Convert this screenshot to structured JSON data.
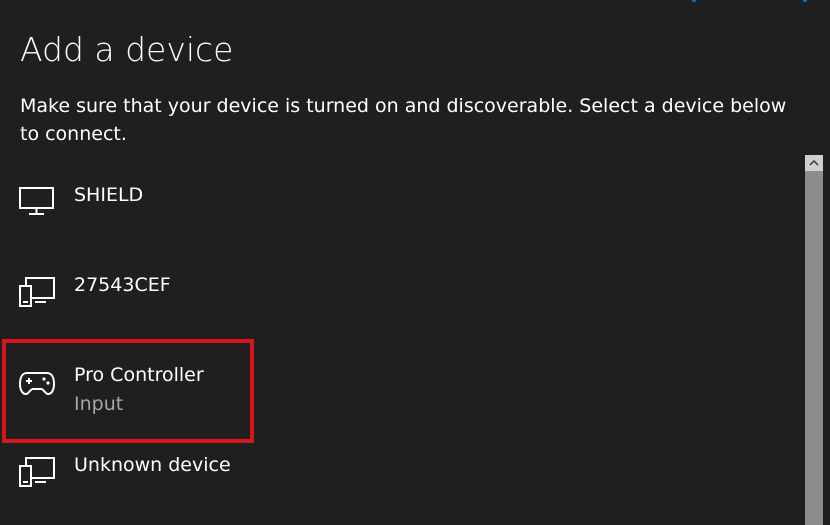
{
  "dialog": {
    "title": "Add a device",
    "description": "Make sure that your device is turned on and discoverable. Select a device below to connect."
  },
  "devices": [
    {
      "name": "SHIELD",
      "subtitle": "",
      "icon": "monitor-icon"
    },
    {
      "name": "27543CEF",
      "subtitle": "",
      "icon": "devices-icon"
    },
    {
      "name": "Pro Controller",
      "subtitle": "Input",
      "icon": "gamepad-icon"
    },
    {
      "name": "Unknown device",
      "subtitle": "",
      "icon": "devices-icon"
    }
  ],
  "colors": {
    "background": "#1f1f1f",
    "highlight": "#d5161d",
    "accent": "#0078d7",
    "subtitle_text": "#a6a6a6"
  }
}
